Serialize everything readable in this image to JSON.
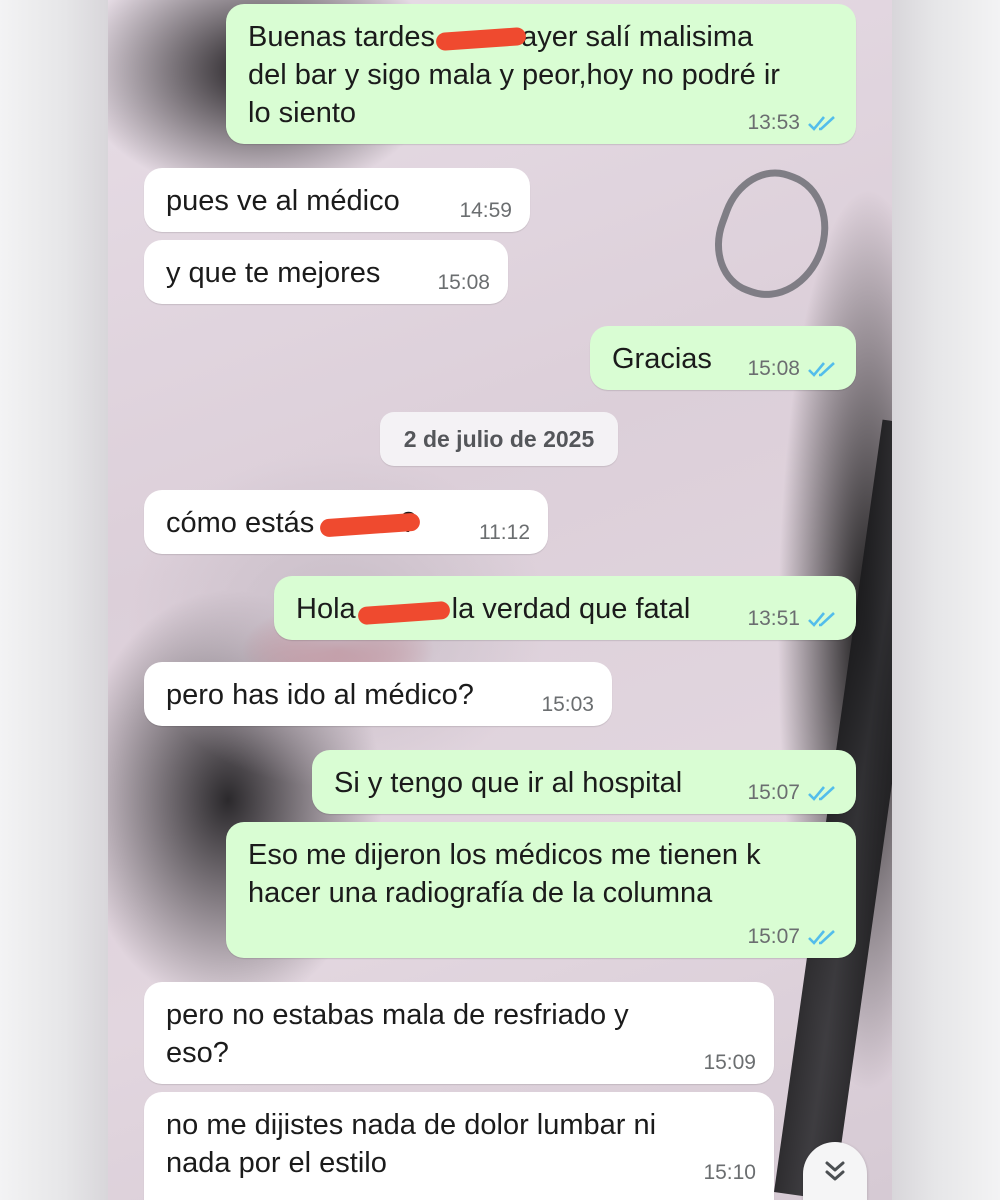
{
  "date_separator": "2 de julio de 2025",
  "colors": {
    "outgoing_bubble": "#d9fdd3",
    "incoming_bubble": "#ffffff",
    "read_ticks": "#53bdeb",
    "redaction": "#ef4a2f"
  },
  "messages": [
    {
      "direction": "out",
      "text_a": "Buenas tardes",
      "text_b": " ayer salí malisima",
      "text_c": "del bar y sigo mala y peor,hoy no podré ir",
      "text_d": "lo siento",
      "time": "13:53",
      "status_icon": "double-check-read-icon"
    },
    {
      "direction": "in",
      "text": "pues ve al médico",
      "time": "14:59"
    },
    {
      "direction": "in",
      "text": "y que te mejores",
      "time": "15:08"
    },
    {
      "direction": "out",
      "text": "Gracias",
      "time": "15:08",
      "status_icon": "double-check-read-icon"
    },
    {
      "direction": "in",
      "text_a": "cómo estás",
      "text_b": "?",
      "time": "11:12"
    },
    {
      "direction": "out",
      "text_a": "Hola",
      "text_b": "la verdad que fatal",
      "time": "13:51",
      "status_icon": "double-check-read-icon"
    },
    {
      "direction": "in",
      "text": "pero has ido al médico?",
      "time": "15:03"
    },
    {
      "direction": "out",
      "text": "Si y tengo que ir al hospital",
      "time": "15:07",
      "status_icon": "double-check-read-icon"
    },
    {
      "direction": "out",
      "text_a": "Eso me dijeron los médicos me tienen k",
      "text_b": "hacer una radiografía de la columna",
      "time": "15:07",
      "status_icon": "double-check-read-icon"
    },
    {
      "direction": "in",
      "text_a": "pero no estabas mala de resfriado y",
      "text_b": "eso?",
      "time": "15:09"
    },
    {
      "direction": "in",
      "text_a": "no me dijistes nada de dolor lumbar ni",
      "text_b": "nada por el estilo",
      "time": "15:10"
    }
  ],
  "scroll_button_icon": "chevron-double-down-icon"
}
